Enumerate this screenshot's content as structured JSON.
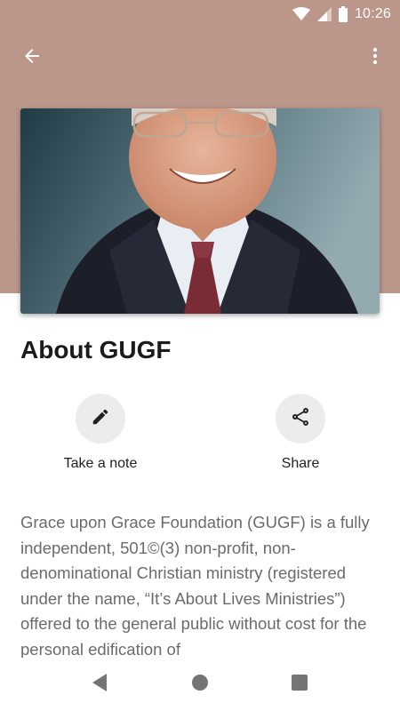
{
  "status_bar": {
    "time": "10:26",
    "icons": [
      "wifi-icon",
      "cellular-signal-icon",
      "battery-icon"
    ]
  },
  "toolbar": {
    "back_icon": "arrow-back-icon",
    "menu_icon": "more-vert-icon"
  },
  "hero": {
    "image": "portrait-photo"
  },
  "page": {
    "title": "About GUGF"
  },
  "actions": [
    {
      "label": "Take a note",
      "icon": "pencil-icon"
    },
    {
      "label": "Share",
      "icon": "share-icon"
    }
  ],
  "content": {
    "body": "Grace upon Grace Foundation (GUGF) is a fully independent, 501©(3) non-profit, non-denominational Christian ministry (registered under the name, “It’s About Lives Ministries”) offered to the general public without cost for the personal edification of"
  },
  "nav_bar": {
    "icons": [
      "nav-back-icon",
      "nav-home-icon",
      "nav-recents-icon"
    ]
  },
  "colors": {
    "header": "#bb978b",
    "action_circle": "#ececec",
    "body_text": "#6b6b6b"
  }
}
